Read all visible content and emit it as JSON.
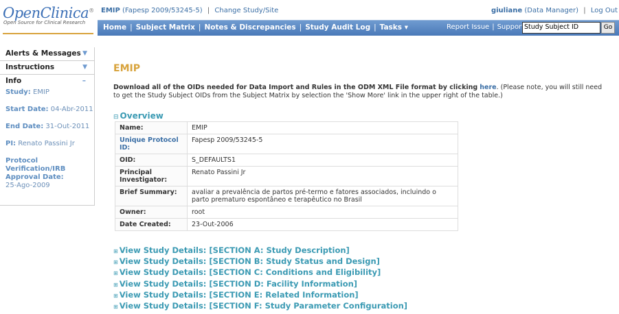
{
  "logo": {
    "title": "OpenClinica",
    "reg": "®",
    "subtitle": "Open Source for Clinical Research"
  },
  "top": {
    "study_label": "EMIP",
    "study_detail": "(Fapesp 2009/53245-5)",
    "sep": "|",
    "change_study": "Change Study/Site",
    "user": "giuliane",
    "role": "(Data Manager)",
    "logout": "Log Out"
  },
  "nav": {
    "items": [
      "Home",
      "Subject Matrix",
      "Notes & Discrepancies",
      "Study Audit Log",
      "Tasks ▾"
    ],
    "report_issue": "Report Issue",
    "support": "Support",
    "search_value": "Study Subject ID",
    "go_label": "Go"
  },
  "sidebar": {
    "tabs": [
      {
        "label": "Alerts & Messages",
        "arrow": "▼"
      },
      {
        "label": "Instructions",
        "arrow": "▼"
      }
    ],
    "info": {
      "label": "Info",
      "collapse": "–",
      "study_label": "Study:",
      "study_value": "EMIP",
      "start_label": "Start Date:",
      "start_value": "04-Abr-2011",
      "end_label": "End Date:",
      "end_value": "31-Out-2011",
      "pi_label": "PI:",
      "pi_value": "Renato Passini Jr",
      "irb_label": "Protocol Verification/IRB Approval Date:",
      "irb_value": "25-Ago-2009"
    }
  },
  "main": {
    "title": "EMIP",
    "download_bold": "Download all of the OIDs needed for Data Import and Rules in the ODM XML File format by clicking",
    "download_here": "here",
    "download_rest": ". (Please note, you will still need to get the Study Subject OIDs from the Subject Matrix by selection the 'Show More' link in the upper right of the table.)",
    "overview_label": "Overview",
    "overview": [
      {
        "key": "Name:",
        "value": "EMIP"
      },
      {
        "key": "Unique Protocol ID:",
        "value": "Fapesp 2009/53245-5"
      },
      {
        "key": "OID:",
        "value": "S_DEFAULTS1"
      },
      {
        "key": "Principal Investigator:",
        "value": "Renato Passini Jr"
      },
      {
        "key": "Brief Summary:",
        "value": "avaliar a prevalência de partos pré-termo e fatores associados, incluindo o parto prematuro espontâneo e terapêutico no Brasil"
      },
      {
        "key": "Owner:",
        "value": "root"
      },
      {
        "key": "Date Created:",
        "value": "23-Out-2006"
      }
    ],
    "sections": [
      "View Study Details: [SECTION A: Study Description]",
      "View Study Details: [SECTION B: Study Status and Design]",
      "View Study Details: [SECTION C: Conditions and Eligibility]",
      "View Study Details: [SECTION D: Facility Information]",
      "View Study Details: [SECTION E: Related Information]",
      "View Study Details: [SECTION F: Study Parameter Configuration]"
    ]
  }
}
